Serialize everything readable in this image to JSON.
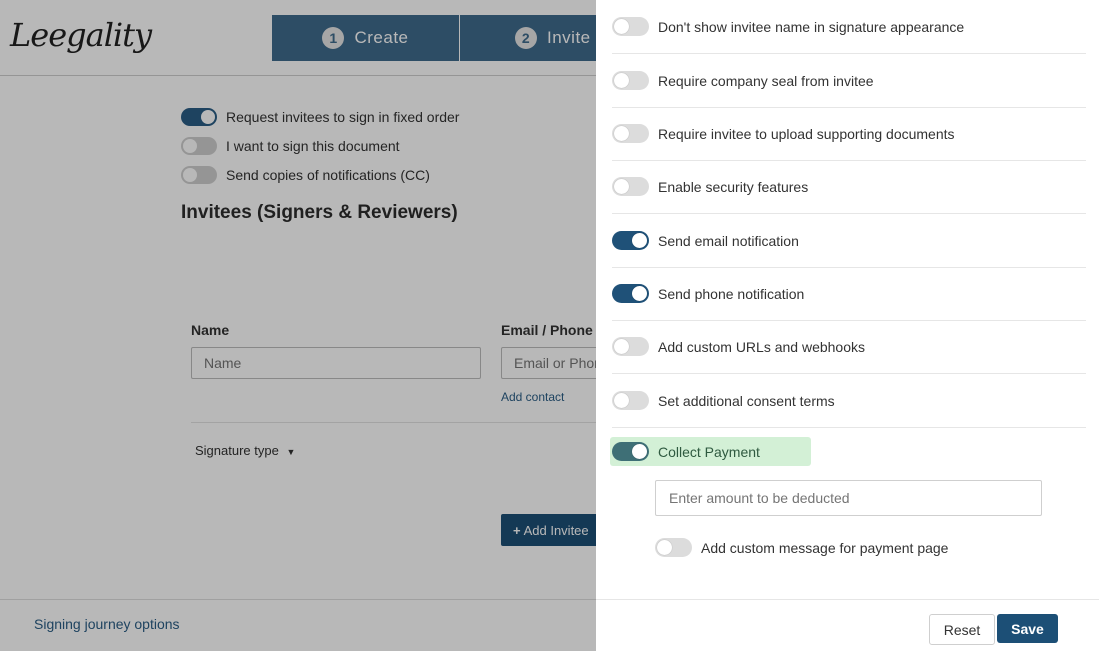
{
  "header": {
    "logo_text": "Leegality",
    "steps": [
      {
        "number": "1",
        "label": "Create"
      },
      {
        "number": "2",
        "label": "Invite"
      }
    ]
  },
  "options": [
    {
      "label": "Request invitees to sign in fixed order",
      "on": true
    },
    {
      "label": "I want to sign this document",
      "on": false
    },
    {
      "label": "Send copies of notifications (CC)",
      "on": false
    }
  ],
  "invitees": {
    "title": "Invitees (Signers & Reviewers)",
    "name_label": "Name",
    "name_placeholder": "Name",
    "email_label": "Email / Phone",
    "email_placeholder": "Email or Phone",
    "add_contact": "Add contact",
    "signature_type": "Signature type",
    "add_invitee": "Add Invitee"
  },
  "footer": {
    "journey_options": "Signing journey options"
  },
  "panel": {
    "settings": [
      {
        "label": "Don't show invitee name in signature appearance",
        "on": false
      },
      {
        "label": "Require company seal from invitee",
        "on": false
      },
      {
        "label": "Require invitee to upload supporting documents",
        "on": false
      },
      {
        "label": "Enable security features",
        "on": false
      },
      {
        "label": "Send email notification",
        "on": true
      },
      {
        "label": "Send phone notification",
        "on": true
      },
      {
        "label": "Add custom URLs and webhooks",
        "on": false
      },
      {
        "label": "Set additional consent terms",
        "on": false
      }
    ],
    "collect_payment": {
      "label": "Collect Payment",
      "on": true
    },
    "amount_placeholder": "Enter amount to be deducted",
    "custom_message": {
      "label": "Add custom message for payment page",
      "on": false
    },
    "reset_label": "Reset",
    "save_label": "Save"
  },
  "colors": {
    "brand": "#1c4f76",
    "step_bg": "#3f6b8c",
    "payment_highlight": "#d3f0d6"
  }
}
